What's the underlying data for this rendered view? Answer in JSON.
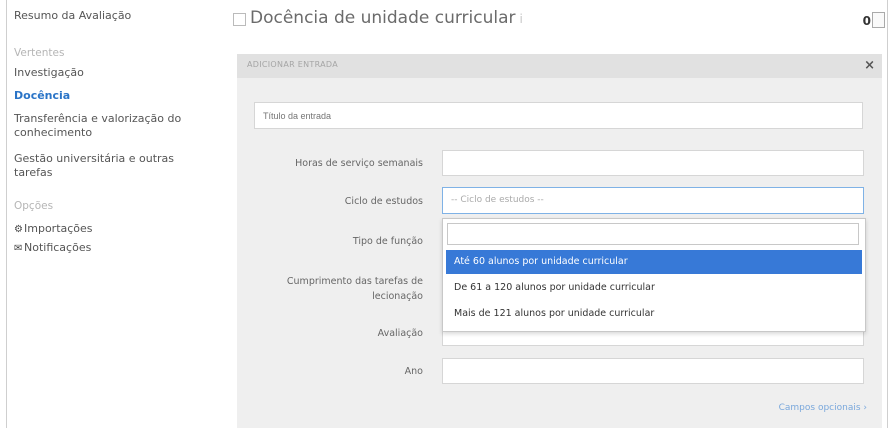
{
  "sidebar": {
    "summary": "Resumo da Avaliação",
    "section_vertentes": "Vertentes",
    "items": [
      {
        "label": "Investigação"
      },
      {
        "label": "Docência"
      },
      {
        "label": "Transferência e valorização do conhecimento"
      },
      {
        "label": "Gestão universitária e outras tarefas"
      }
    ],
    "section_opcoes": "Opções",
    "importacoes": "Importações",
    "notificacoes": "Notificações"
  },
  "header": {
    "title": "Docência de unidade curricular",
    "help": "i",
    "count": "0"
  },
  "panel": {
    "head_label": "Adicionar Entrada",
    "close": "×",
    "title_placeholder": "Título da entrada",
    "fields": {
      "horas_label": "Horas de serviço semanais",
      "ciclo_label": "Ciclo de estudos",
      "ciclo_value": "-- Ciclo de estudos --",
      "tipo_label": "Tipo de função",
      "cumprimento_label_1": "Cumprimento das tarefas de",
      "cumprimento_label_2": "lecionação",
      "avaliacao_label": "Avaliação",
      "ano_label": "Ano"
    },
    "dropdown_options": [
      "Até 60 alunos por unidade curricular",
      "De 61 a 120 alunos por unidade curricular",
      "Mais de 121 alunos por unidade curricular"
    ],
    "optional_link": "Campos opcionais ›"
  },
  "colors": {
    "accent": "#2a74c7",
    "highlight": "#3779d7"
  }
}
